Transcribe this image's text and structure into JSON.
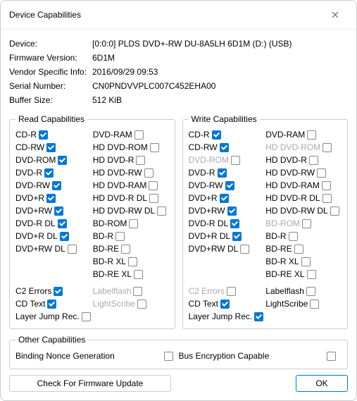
{
  "window": {
    "title": "Device Capabilities"
  },
  "info": {
    "device_label": "Device:",
    "device_value": "[0:0:0] PLDS DVD+-RW DU-8A5LH 6D1M (D:) (USB)",
    "firmware_label": "Firmware Version:",
    "firmware_value": "6D1M",
    "vendor_label": "Vendor Specific Info:",
    "vendor_value": "2016/09/29 09:53",
    "serial_label": "Serial Number:",
    "serial_value": "CN0PNDVVPLC007C452EHA00",
    "buffer_label": "Buffer Size:",
    "buffer_value": "512 KiB"
  },
  "read": {
    "legend": "Read Capabilities",
    "left": [
      {
        "label": "CD-R",
        "checked": true
      },
      {
        "label": "CD-RW",
        "checked": true
      },
      {
        "label": "DVD-ROM",
        "checked": true
      },
      {
        "label": "DVD-R",
        "checked": true
      },
      {
        "label": "DVD-RW",
        "checked": true
      },
      {
        "label": "DVD+R",
        "checked": true
      },
      {
        "label": "DVD+RW",
        "checked": true
      },
      {
        "label": "DVD-R DL",
        "checked": true
      },
      {
        "label": "DVD+R DL",
        "checked": true
      },
      {
        "label": "DVD+RW DL",
        "checked": false
      }
    ],
    "right": [
      {
        "label": "DVD-RAM",
        "checked": false
      },
      {
        "label": "HD DVD-ROM",
        "checked": false
      },
      {
        "label": "HD DVD-R",
        "checked": false
      },
      {
        "label": "HD DVD-RW",
        "checked": false
      },
      {
        "label": "HD DVD-RAM",
        "checked": false
      },
      {
        "label": "HD DVD-R DL",
        "checked": false
      },
      {
        "label": "HD DVD-RW DL",
        "checked": false
      },
      {
        "label": "BD-ROM",
        "checked": false
      },
      {
        "label": "BD-R",
        "checked": false
      },
      {
        "label": "BD-RE",
        "checked": false
      },
      {
        "label": "BD-R XL",
        "checked": false
      },
      {
        "label": "BD-RE XL",
        "checked": false
      }
    ],
    "extra_left": [
      {
        "label": "C2 Errors",
        "checked": true
      },
      {
        "label": "CD Text",
        "checked": true
      },
      {
        "label": "Layer Jump Rec.",
        "checked": false
      }
    ],
    "extra_right": [
      {
        "label": "Labelflash",
        "checked": false,
        "disabled": true
      },
      {
        "label": "LightScribe",
        "checked": false,
        "disabled": true
      }
    ]
  },
  "write": {
    "legend": "Write Capabilities",
    "left": [
      {
        "label": "CD-R",
        "checked": true
      },
      {
        "label": "CD-RW",
        "checked": true
      },
      {
        "label": "DVD-ROM",
        "checked": false,
        "disabled": true
      },
      {
        "label": "DVD-R",
        "checked": true
      },
      {
        "label": "DVD-RW",
        "checked": true
      },
      {
        "label": "DVD+R",
        "checked": true
      },
      {
        "label": "DVD+RW",
        "checked": true
      },
      {
        "label": "DVD-R DL",
        "checked": true
      },
      {
        "label": "DVD+R DL",
        "checked": true
      },
      {
        "label": "DVD+RW DL",
        "checked": false
      }
    ],
    "right": [
      {
        "label": "DVD-RAM",
        "checked": false
      },
      {
        "label": "HD DVD-ROM",
        "checked": false,
        "disabled": true
      },
      {
        "label": "HD DVD-R",
        "checked": false
      },
      {
        "label": "HD DVD-RW",
        "checked": false
      },
      {
        "label": "HD DVD-RAM",
        "checked": false
      },
      {
        "label": "HD DVD-R DL",
        "checked": false
      },
      {
        "label": "HD DVD-RW DL",
        "checked": false
      },
      {
        "label": "BD-ROM",
        "checked": false,
        "disabled": true
      },
      {
        "label": "BD-R",
        "checked": false
      },
      {
        "label": "BD-RE",
        "checked": false
      },
      {
        "label": "BD-R XL",
        "checked": false
      },
      {
        "label": "BD-RE XL",
        "checked": false
      }
    ],
    "extra_left": [
      {
        "label": "C2 Errors",
        "checked": false,
        "disabled": true
      },
      {
        "label": "CD Text",
        "checked": true
      },
      {
        "label": "Layer Jump Rec.",
        "checked": true
      }
    ],
    "extra_right": [
      {
        "label": "Labelflash",
        "checked": false
      },
      {
        "label": "LightScribe",
        "checked": false
      }
    ]
  },
  "other": {
    "legend": "Other Capabilities",
    "binding_label": "Binding Nonce Generation",
    "binding_checked": false,
    "bus_label": "Bus Encryption Capable",
    "bus_checked": false
  },
  "footer": {
    "check_label": "Check For Firmware Update",
    "ok_label": "OK"
  }
}
